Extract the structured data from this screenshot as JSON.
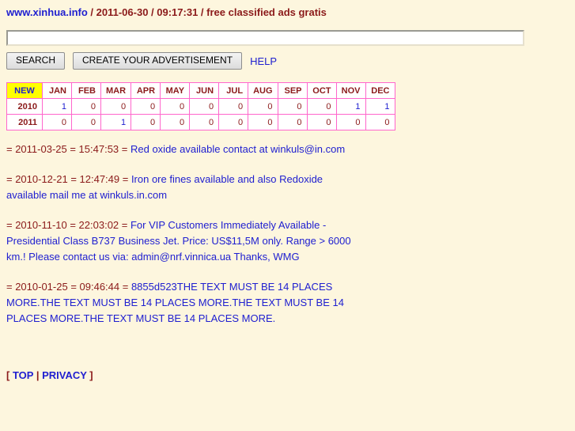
{
  "header": {
    "brand": "www.xinhua.info",
    "sep1": " / ",
    "date": "2011-06-30",
    "sep2": " / ",
    "time": "09:17:31",
    "sep3": " / ",
    "tagline": "free classified ads gratis"
  },
  "search": {
    "value": "",
    "placeholder": "",
    "search_label": "SEARCH",
    "create_label": "CREATE YOUR ADVERTISEMENT",
    "help_label": "HELP"
  },
  "month_table": {
    "new_label": "NEW",
    "months": [
      "JAN",
      "FEB",
      "MAR",
      "APR",
      "MAY",
      "JUN",
      "JUL",
      "AUG",
      "SEP",
      "OCT",
      "NOV",
      "DEC"
    ],
    "rows": [
      {
        "year": "2010",
        "counts": [
          "1",
          "0",
          "0",
          "0",
          "0",
          "0",
          "0",
          "0",
          "0",
          "0",
          "1",
          "1"
        ]
      },
      {
        "year": "2011",
        "counts": [
          "0",
          "0",
          "1",
          "0",
          "0",
          "0",
          "0",
          "0",
          "0",
          "0",
          "0",
          "0"
        ]
      }
    ]
  },
  "listings": [
    {
      "meta": "= 2011-03-25 = 15:47:53 = ",
      "text": "Red oxide available contact at winkuls@in.com"
    },
    {
      "meta": "= 2010-12-21 = 12:47:49 = ",
      "text": "Iron ore fines available and also Redoxide available mail me at winkuls.in.com"
    },
    {
      "meta": "= 2010-11-10 = 22:03:02 = ",
      "text": "For VIP Customers Immediately Available - Presidential Class B737 Business Jet. Price: US$11,5M only. Range > 6000 km.! Please contact us via: admin@nrf.vinnica.ua Thanks, WMG"
    },
    {
      "meta": "= 2010-01-25 = 09:46:44 = ",
      "text": "8855d523THE TEXT MUST BE 14 PLACES MORE.THE TEXT MUST BE 14 PLACES MORE.THE TEXT MUST BE 14 PLACES MORE.THE TEXT MUST BE 14 PLACES MORE."
    }
  ],
  "footer": {
    "open_bracket": "[ ",
    "top_label": "TOP",
    "pipe": " | ",
    "privacy_label": "PRIVACY",
    "close_bracket": " ]"
  },
  "colors": {
    "background": "#fdf6de",
    "accent_red": "#8b1a1a",
    "link_blue": "#2020d0",
    "table_border": "#ff66cc",
    "new_cell_bg": "#ffff00"
  }
}
